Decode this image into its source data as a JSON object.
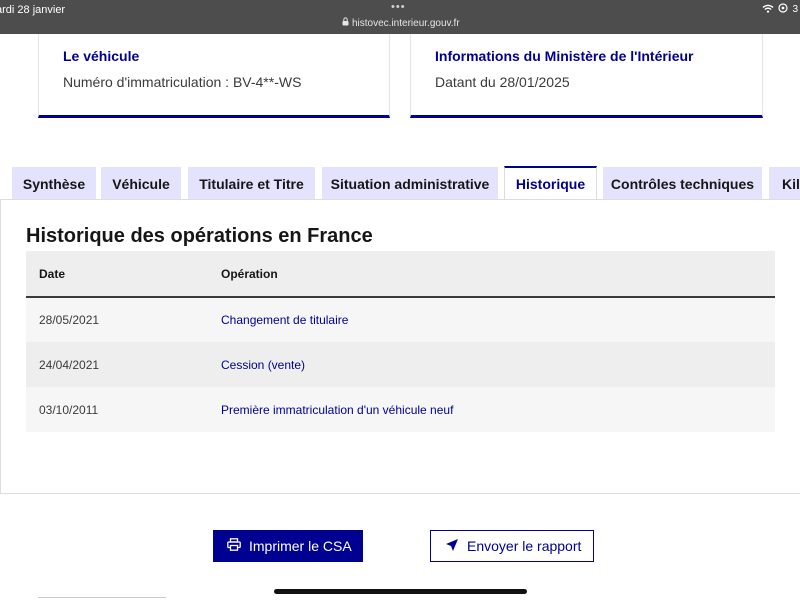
{
  "statusbar": {
    "date": "ardi 28 janvier",
    "url": "histovec.interieur.gouv.fr",
    "battery_fragment": "3"
  },
  "cards": [
    {
      "title": "Le véhicule",
      "text": "Numéro d'immatriculation : BV-4**-WS"
    },
    {
      "title": "Informations du Ministère de l'Intérieur",
      "text": "Datant du 28/01/2025"
    }
  ],
  "tabs": [
    {
      "label": "Synthèse",
      "active": false
    },
    {
      "label": "Véhicule",
      "active": false
    },
    {
      "label": "Titulaire et Titre",
      "active": false
    },
    {
      "label": "Situation administrative",
      "active": false
    },
    {
      "label": "Historique",
      "active": true
    },
    {
      "label": "Contrôles techniques",
      "active": false
    },
    {
      "label": "Kil",
      "active": false
    }
  ],
  "history": {
    "title": "Historique des opérations en France",
    "columns": [
      "Date",
      "Opération"
    ],
    "rows": [
      {
        "date": "28/05/2021",
        "operation": "Changement de titulaire"
      },
      {
        "date": "24/04/2021",
        "operation": "Cession (vente)"
      },
      {
        "date": "03/10/2011",
        "operation": "Première immatriculation d'un véhicule neuf"
      }
    ]
  },
  "actions": {
    "print_label": "Imprimer le CSA",
    "send_label": "Envoyer le rapport"
  },
  "colors": {
    "accent": "#000091",
    "tab_inactive_bg": "#e3e3fd",
    "status_bar": "#4d4d4d"
  },
  "icons": {
    "print": "printer-icon",
    "send": "send-icon",
    "lock": "lock-icon",
    "wifi": "wifi-icon"
  }
}
